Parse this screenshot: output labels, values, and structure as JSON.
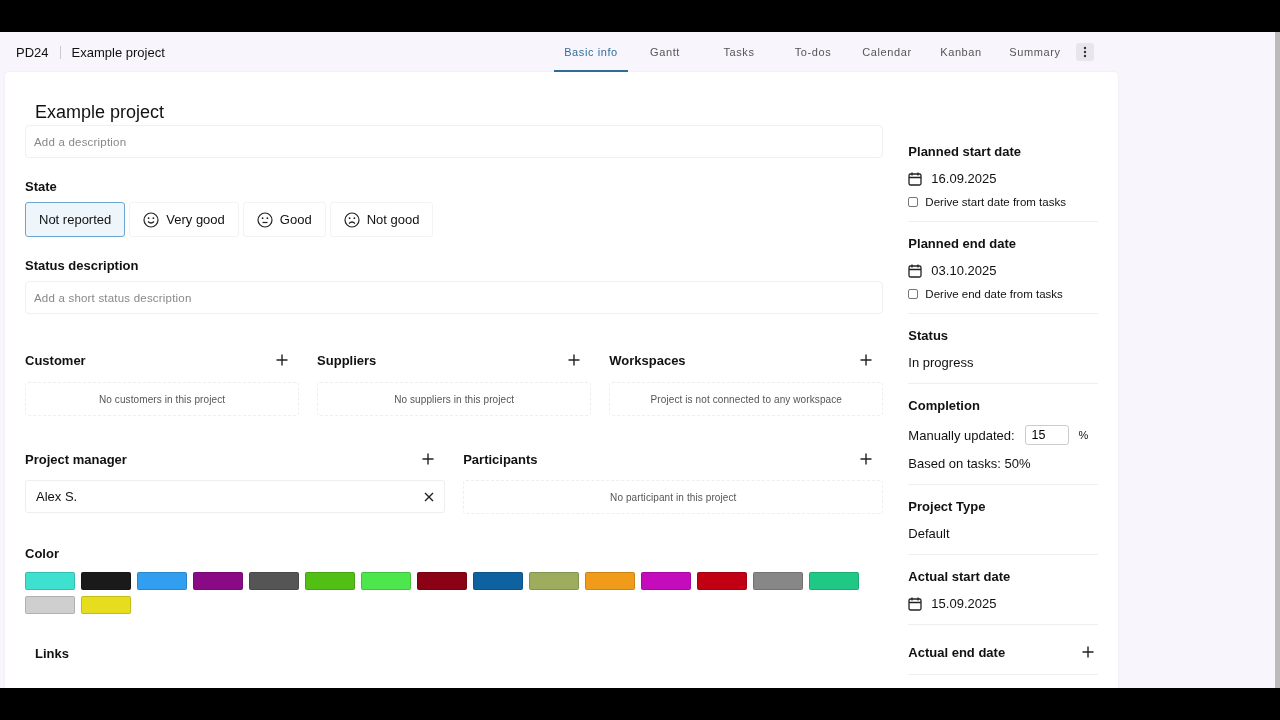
{
  "header": {
    "app": "PD24",
    "project": "Example project",
    "tabs": [
      {
        "label": "Basic info",
        "selected": true
      },
      {
        "label": "Gantt",
        "selected": false
      },
      {
        "label": "Tasks",
        "selected": false
      },
      {
        "label": "To-dos",
        "selected": false
      },
      {
        "label": "Calendar",
        "selected": false
      },
      {
        "label": "Kanban",
        "selected": false
      },
      {
        "label": "Summary",
        "selected": false
      }
    ]
  },
  "title": "Example project",
  "description": {
    "placeholder": "Add a description"
  },
  "state": {
    "label": "State",
    "options": [
      {
        "label": "Not reported",
        "kind": "none",
        "selected": true
      },
      {
        "label": "Very good",
        "kind": "happy",
        "selected": false
      },
      {
        "label": "Good",
        "kind": "neutral",
        "selected": false
      },
      {
        "label": "Not good",
        "kind": "sad",
        "selected": false
      }
    ]
  },
  "status_description": {
    "label": "Status description",
    "placeholder": "Add a short status description"
  },
  "relations": [
    {
      "label": "Customer",
      "empty": "No customers in this project"
    },
    {
      "label": "Suppliers",
      "empty": "No suppliers in this project"
    },
    {
      "label": "Workspaces",
      "empty": "Project is not connected to any workspace"
    }
  ],
  "people": [
    {
      "label": "Project manager",
      "kind": "person",
      "value": "Alex S."
    },
    {
      "label": "Participants",
      "kind": "empty",
      "empty": "No participant in this project"
    }
  ],
  "color": {
    "label": "Color",
    "swatches": [
      {
        "color": "#3ee0d0"
      },
      {
        "color": "#1a1a1a"
      },
      {
        "color": "#319ef0"
      },
      {
        "color": "#8a0a85"
      },
      {
        "color": "#555555"
      },
      {
        "color": "#52bf14"
      },
      {
        "color": "#4de64d"
      },
      {
        "color": "#8a0214"
      },
      {
        "color": "#0e62a0"
      },
      {
        "color": "#9dad5e"
      },
      {
        "color": "#f09c1a"
      },
      {
        "color": "#c40cbc"
      },
      {
        "color": "#c20014"
      },
      {
        "color": "#878787"
      },
      {
        "color": "#20c885"
      },
      {
        "color": "#cfcfcf"
      },
      {
        "color": "#e6dd1e"
      }
    ]
  },
  "links": {
    "label": "Links"
  },
  "sidebar": [
    {
      "kind": "date",
      "label": "Planned start date",
      "value": "16.09.2025",
      "option": {
        "label": "Derive start date from tasks",
        "checked": false
      }
    },
    {
      "kind": "date",
      "label": "Planned end date",
      "value": "03.10.2025",
      "option": {
        "label": "Derive end date from tasks",
        "checked": false
      }
    },
    {
      "kind": "text",
      "label": "Status",
      "value": "In progress"
    },
    {
      "kind": "completion",
      "label": "Completion",
      "manual_label": "Manually updated:",
      "manual_value": "15",
      "unit": "%",
      "based": "Based on tasks: 50%"
    },
    {
      "kind": "text",
      "label": "Project Type",
      "value": "Default"
    },
    {
      "kind": "date",
      "label": "Actual start date",
      "value": "15.09.2025"
    },
    {
      "kind": "add",
      "label": "Actual end date"
    }
  ]
}
